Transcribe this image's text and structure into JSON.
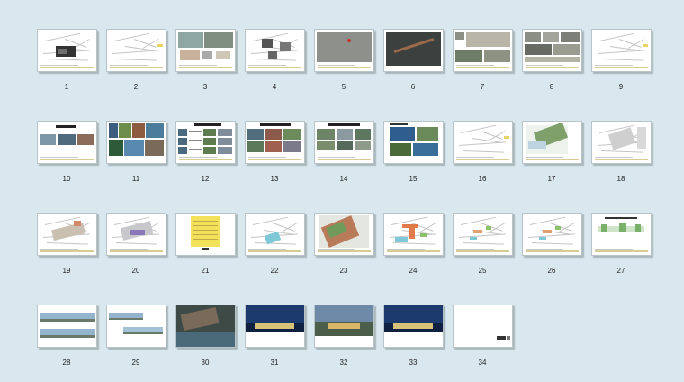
{
  "slides": [
    {
      "number": "1",
      "style": "sketch-photo"
    },
    {
      "number": "2",
      "style": "sketch"
    },
    {
      "number": "3",
      "style": "map-collage"
    },
    {
      "number": "4",
      "style": "sketch-boxes"
    },
    {
      "number": "5",
      "style": "aerial-gray"
    },
    {
      "number": "6",
      "style": "aerial-dark"
    },
    {
      "number": "7",
      "style": "photo-strip"
    },
    {
      "number": "8",
      "style": "photo-grid"
    },
    {
      "number": "9",
      "style": "sketch"
    },
    {
      "number": "10",
      "style": "title-photos"
    },
    {
      "number": "11",
      "style": "photo-mosaic"
    },
    {
      "number": "12",
      "style": "photo-list"
    },
    {
      "number": "13",
      "style": "photo-table"
    },
    {
      "number": "14",
      "style": "photo-row"
    },
    {
      "number": "15",
      "style": "photo-blue"
    },
    {
      "number": "16",
      "style": "sketch"
    },
    {
      "number": "17",
      "style": "site-plan-green"
    },
    {
      "number": "18",
      "style": "site-plan-gray"
    },
    {
      "number": "19",
      "style": "site-plan-mixed"
    },
    {
      "number": "20",
      "style": "site-plan-purple"
    },
    {
      "number": "21",
      "style": "table-yellow"
    },
    {
      "number": "22",
      "style": "plan-blue"
    },
    {
      "number": "23",
      "style": "master-plan"
    },
    {
      "number": "24",
      "style": "plan-colored"
    },
    {
      "number": "25",
      "style": "plan-sparse"
    },
    {
      "number": "26",
      "style": "plan-sparse"
    },
    {
      "number": "27",
      "style": "elevation-green"
    },
    {
      "number": "28",
      "style": "elevation-strips"
    },
    {
      "number": "29",
      "style": "elevation-offset"
    },
    {
      "number": "30",
      "style": "render-aerial"
    },
    {
      "number": "31",
      "style": "render-night"
    },
    {
      "number": "32",
      "style": "render-dusk"
    },
    {
      "number": "33",
      "style": "render-night"
    },
    {
      "number": "34",
      "style": "blank"
    }
  ]
}
